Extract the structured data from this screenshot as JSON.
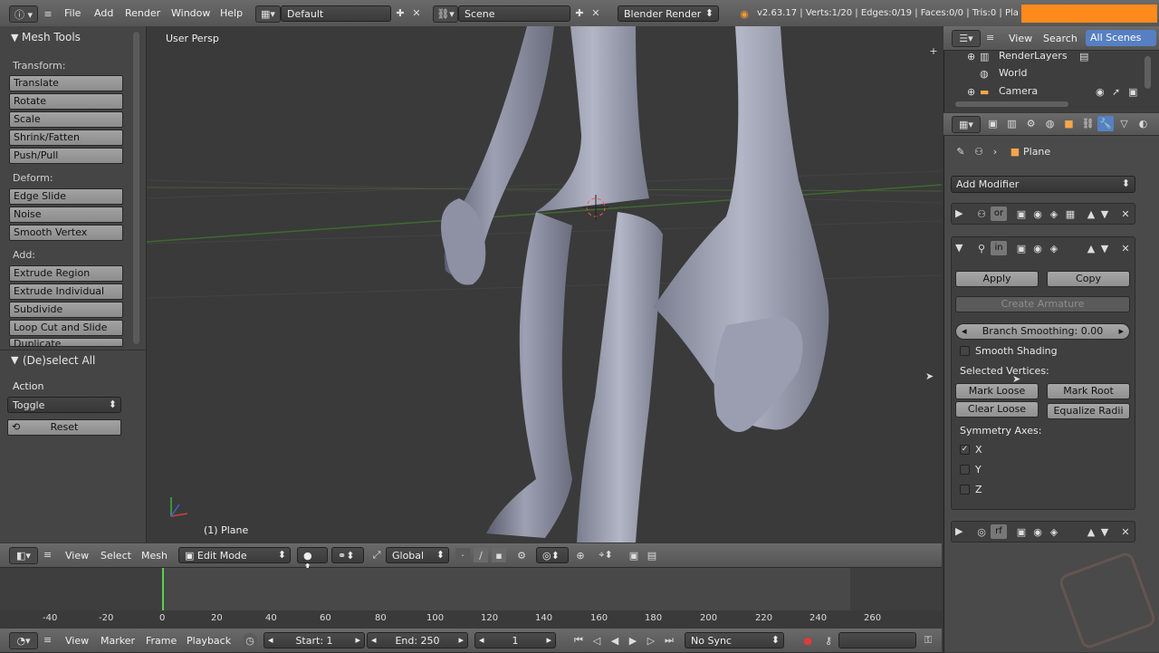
{
  "topbar": {
    "menus": [
      "File",
      "Add",
      "Render",
      "Window",
      "Help"
    ],
    "screen_layout": "Default",
    "scene": "Scene",
    "engine": "Blender Render",
    "stats": "v2.63.17 | Verts:1/20 | Edges:0/19 | Faces:0/0 | Tris:0 | Pla"
  },
  "toolshelf": {
    "title": "Mesh Tools",
    "transform_label": "Transform:",
    "transform": [
      "Translate",
      "Rotate",
      "Scale",
      "Shrink/Fatten",
      "Push/Pull"
    ],
    "deform_label": "Deform:",
    "deform": [
      "Edge Slide",
      "Noise",
      "Smooth Vertex"
    ],
    "add_label": "Add:",
    "add": [
      "Extrude Region",
      "Extrude Individual",
      "Subdivide",
      "Loop Cut and Slide",
      "Duplicate"
    ],
    "operator_title": "(De)select All",
    "action_label": "Action",
    "action_value": "Toggle",
    "reset_label": "Reset"
  },
  "viewport": {
    "view_name": "User Persp",
    "object_label": "(1) Plane"
  },
  "viewport_header": {
    "menus": [
      "View",
      "Select",
      "Mesh"
    ],
    "mode": "Edit Mode",
    "orientation": "Global"
  },
  "outliner": {
    "menus": [
      "View",
      "Search"
    ],
    "filter": "All Scenes",
    "items": [
      "RenderLayers",
      "World",
      "Camera"
    ]
  },
  "properties": {
    "object_name": "Plane",
    "add_modifier": "Add Modifier",
    "mod1_name": "or",
    "mod2_name": "in",
    "apply": "Apply",
    "copy": "Copy",
    "create_armature": "Create Armature",
    "branch_smoothing": "Branch Smoothing: 0.00",
    "smooth_shading": "Smooth Shading",
    "selected_vertices": "Selected Vertices:",
    "mark_loose": "Mark Loose",
    "mark_root": "Mark Root",
    "clear_loose": "Clear Loose",
    "equalize_radii": "Equalize Radii",
    "symmetry_axes": "Symmetry Axes:",
    "axes": [
      "X",
      "Y",
      "Z"
    ],
    "axes_checked": [
      true,
      false,
      false
    ],
    "mod3_name": "rf"
  },
  "timeline": {
    "ticks": [
      "-40",
      "-20",
      "0",
      "20",
      "40",
      "60",
      "80",
      "100",
      "120",
      "140",
      "160",
      "180",
      "200",
      "220",
      "240",
      "260"
    ],
    "menus": [
      "View",
      "Marker",
      "Frame",
      "Playback"
    ],
    "start": "Start: 1",
    "end": "End: 250",
    "current": "1",
    "sync": "No Sync"
  },
  "colors": {
    "accent": "#5680c2",
    "record": "#ff8a1c",
    "playhead": "#5bd14d"
  }
}
